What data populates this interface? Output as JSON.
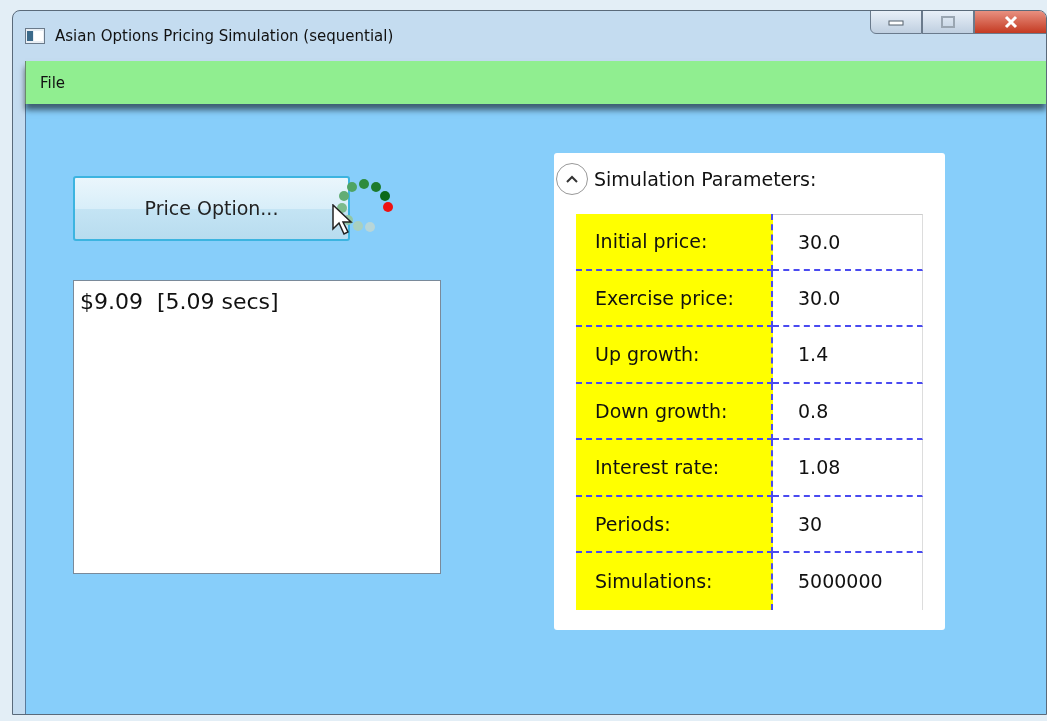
{
  "window": {
    "title": "Asian Options Pricing Simulation (sequential)"
  },
  "menu": [
    {
      "label": "File"
    }
  ],
  "price_button": {
    "label": "Price Option..."
  },
  "result_box": {
    "value": "$9.09  [5.09 secs]"
  },
  "parameters": {
    "title": "Simulation Parameters:",
    "expanded": true,
    "rows": [
      {
        "label": "Initial price:",
        "value": "30.0"
      },
      {
        "label": "Exercise price:",
        "value": "30.0"
      },
      {
        "label": "Up growth:",
        "value": "1.4"
      },
      {
        "label": "Down growth:",
        "value": "0.8"
      },
      {
        "label": "Interest rate:",
        "value": "1.08"
      },
      {
        "label": "Periods:",
        "value": "30"
      },
      {
        "label": "Simulations:",
        "value": "5000000"
      }
    ]
  }
}
